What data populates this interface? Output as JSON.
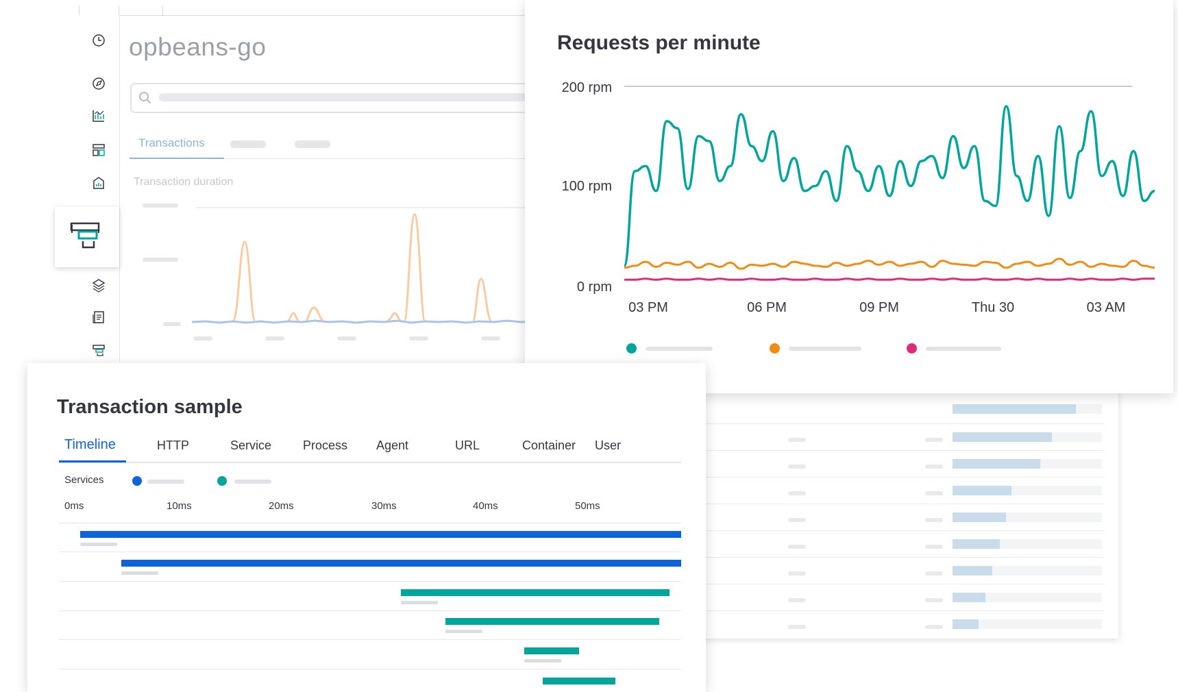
{
  "app": {
    "service_name": "opbeans-go",
    "active_tab": "Transactions",
    "duration_label": "Transaction duration"
  },
  "nav": {
    "icons": [
      "clock-icon",
      "compass-icon",
      "dashboard-chart-icon",
      "layout-grid-icon",
      "building-icon",
      "apm-icon",
      "stack-icon",
      "logs-icon",
      "apm-small-icon"
    ]
  },
  "rpm": {
    "title": "Requests per minute",
    "colors": [
      "#00a69b",
      "#f28b12",
      "#dd2a7b"
    ],
    "chart_data": {
      "type": "line",
      "title": "Requests per minute",
      "y_ticks": [
        "200 rpm",
        "100 rpm",
        "0 rpm"
      ],
      "x_ticks": [
        "03 PM",
        "06 PM",
        "09 PM",
        "Thu 30",
        "03 AM"
      ],
      "ylim": [
        0,
        200
      ],
      "grid": "top line only",
      "legend": "bottom",
      "series": [
        {
          "color": "#00a69b",
          "values": [
            20,
            115,
            120,
            95,
            165,
            158,
            97,
            150,
            145,
            105,
            120,
            172,
            140,
            125,
            155,
            105,
            128,
            95,
            100,
            115,
            85,
            140,
            115,
            95,
            120,
            90,
            125,
            100,
            125,
            130,
            108,
            150,
            118,
            140,
            85,
            80,
            180,
            110,
            85,
            130,
            70,
            160,
            88,
            135,
            175,
            110,
            125,
            90,
            135,
            85,
            95
          ]
        },
        {
          "color": "#f28b12",
          "values": [
            18,
            20,
            24,
            19,
            23,
            21,
            24,
            18,
            22,
            19,
            23,
            17,
            21,
            20,
            22,
            19,
            24,
            22,
            20,
            19,
            23,
            20,
            22,
            25,
            21,
            24,
            20,
            22,
            24,
            19,
            25,
            22,
            21,
            20,
            24,
            23,
            18,
            22,
            24,
            20,
            22,
            27,
            21,
            24,
            19,
            22,
            20,
            19,
            25,
            20,
            18
          ]
        },
        {
          "color": "#dd2a7b",
          "values": [
            6,
            6,
            7,
            6,
            7,
            6,
            6,
            7,
            6,
            7,
            6,
            6,
            7,
            6,
            6,
            7,
            6,
            6,
            7,
            6,
            6,
            7,
            6,
            7,
            6,
            6,
            7,
            6,
            6,
            7,
            6,
            7,
            6,
            6,
            7,
            6,
            6,
            7,
            6,
            7,
            6,
            6,
            7,
            6,
            7,
            6,
            6,
            7,
            6,
            7,
            7
          ]
        }
      ]
    }
  },
  "sample": {
    "title": "Transaction sample",
    "tabs": [
      "Timeline",
      "HTTP",
      "Service",
      "Process",
      "Agent",
      "URL",
      "Container",
      "User"
    ],
    "services_label": "Services",
    "service_colors": [
      "#0b64dd",
      "#00a69b"
    ],
    "ticks": [
      "0ms",
      "10ms",
      "20ms",
      "30ms",
      "40ms",
      "50ms"
    ]
  }
}
